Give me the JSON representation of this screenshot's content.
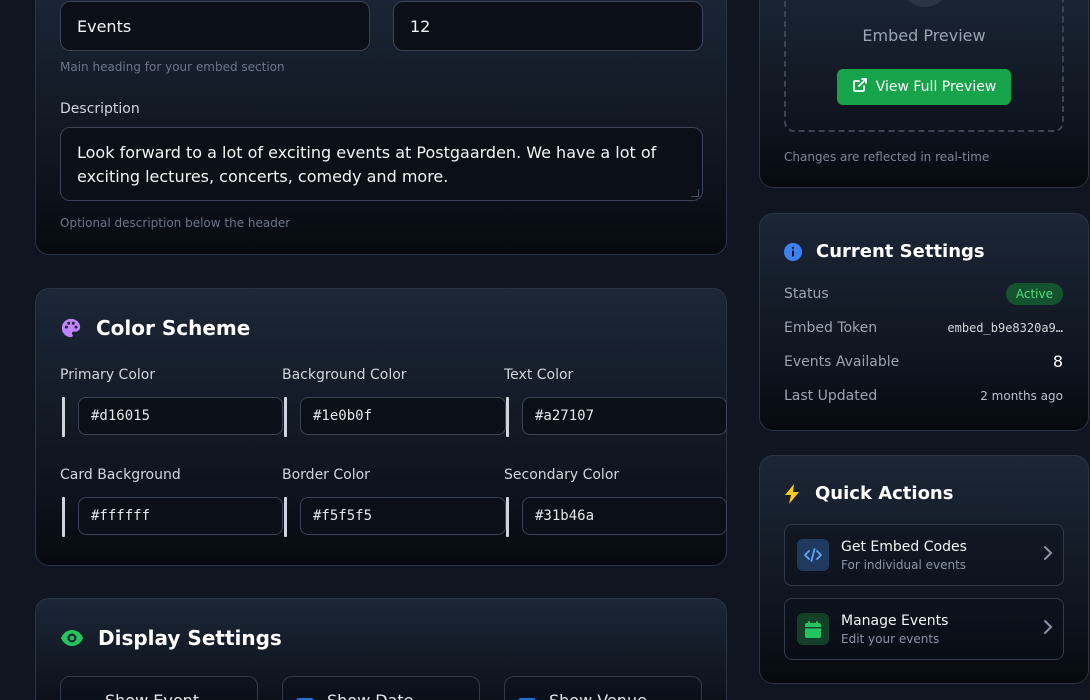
{
  "header_section": {
    "title_value": "Events",
    "count_value": "12",
    "title_hint": "Main heading for your embed section",
    "description_label": "Description",
    "description_value": "Look forward to a lot of exciting events at Postgaarden. We have a lot of exciting lectures, concerts, comedy and more.",
    "description_hint": "Optional description below the header"
  },
  "color_scheme": {
    "title": "Color Scheme",
    "fields": [
      {
        "label": "Primary Color",
        "value": "#d16015"
      },
      {
        "label": "Background Color",
        "value": "#1e0b0f"
      },
      {
        "label": "Text Color",
        "value": "#a27107"
      },
      {
        "label": "Card Background",
        "value": "#ffffff"
      },
      {
        "label": "Border Color",
        "value": "#f5f5f5"
      },
      {
        "label": "Secondary Color",
        "value": "#31b46a"
      }
    ]
  },
  "display_settings": {
    "title": "Display Settings",
    "toggles": [
      {
        "label": "Show Event"
      },
      {
        "label": "Show Date"
      },
      {
        "label": "Show Venue"
      }
    ]
  },
  "preview": {
    "label": "Embed Preview",
    "button_label": "View Full Preview",
    "hint": "Changes are reflected in real-time"
  },
  "current_settings": {
    "title": "Current Settings",
    "rows": [
      {
        "label": "Status",
        "value": "Active"
      },
      {
        "label": "Embed Token",
        "value": "embed_b9e8320a9…"
      },
      {
        "label": "Events Available",
        "value": "8"
      },
      {
        "label": "Last Updated",
        "value": "2 months ago"
      }
    ]
  },
  "quick_actions": {
    "title": "Quick Actions",
    "items": [
      {
        "title": "Get Embed Codes",
        "subtitle": "For individual events",
        "icon": "code-icon"
      },
      {
        "title": "Manage Events",
        "subtitle": "Edit your events",
        "icon": "calendar-icon"
      }
    ]
  },
  "colors": {
    "accent_green": "#16a34a",
    "status_badge_bg": "#14532d",
    "info_blue": "#3b82f6",
    "palette_purple": "#c084fc",
    "eye_green": "#22c55e",
    "bolt_yellow": "#facc15"
  }
}
